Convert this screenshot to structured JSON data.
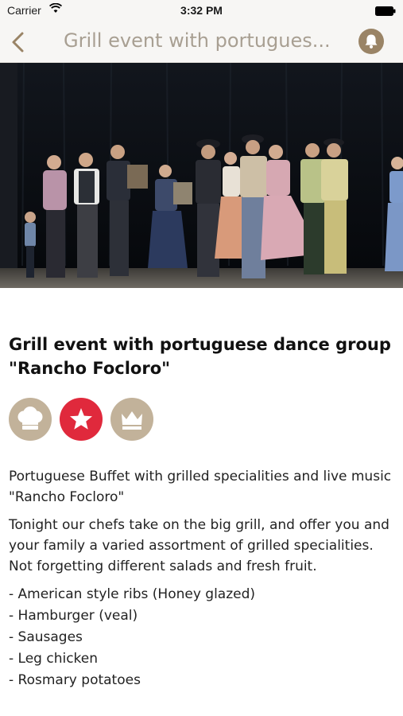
{
  "status_bar": {
    "carrier": "Carrier",
    "time": "3:32 PM",
    "wifi_icon": "wifi-icon",
    "battery_icon": "battery-icon"
  },
  "nav": {
    "title": "Grill event with portugues...",
    "back_icon": "chevron-left-icon",
    "bell_icon": "bell-icon",
    "accent_color": "#9a8466"
  },
  "hero": {
    "image": "photo of a Portuguese folk dance group performing on stage"
  },
  "event": {
    "title": "Grill event with portuguese dance group \"Rancho Focloro\"",
    "badges": [
      {
        "icon": "chef-hat-icon",
        "color": "#c2b29a"
      },
      {
        "icon": "star-icon",
        "color": "#e0293c"
      },
      {
        "icon": "crown-icon",
        "color": "#c2b29a"
      }
    ],
    "subtitle": "Portuguese Buffet with grilled specialities and live music \"Rancho Focloro\"",
    "description": "Tonight our chefs take on the big grill, and offer you and your family a varied assortment of grilled specialities. Not forgetting different salads and fresh fruit.",
    "menu_items": [
      "- American style ribs (Honey glazed)",
      "- Hamburger (veal)",
      "- Sausages",
      "- Leg chicken",
      "- Rosmary potatoes"
    ]
  }
}
